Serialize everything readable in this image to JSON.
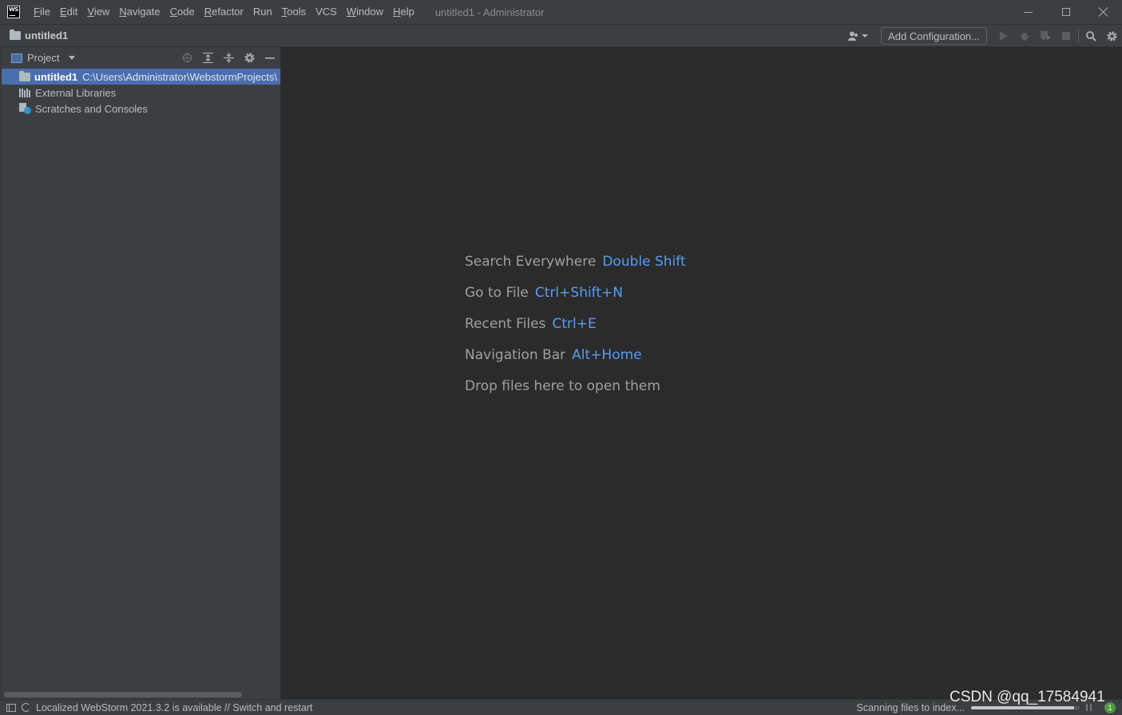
{
  "titlebar": {
    "logo_text": "WS",
    "menu": [
      {
        "label": "File",
        "mnemonic": "F",
        "rest": "ile"
      },
      {
        "label": "Edit",
        "mnemonic": "E",
        "rest": "dit"
      },
      {
        "label": "View",
        "mnemonic": "V",
        "rest": "iew"
      },
      {
        "label": "Navigate",
        "mnemonic": "N",
        "rest": "avigate"
      },
      {
        "label": "Code",
        "mnemonic": "C",
        "rest": "ode"
      },
      {
        "label": "Refactor",
        "mnemonic": "R",
        "rest": "efactor"
      },
      {
        "label": "Run",
        "mnemonic": "R",
        "rest": "un",
        "mnemonic_index": 1
      },
      {
        "label": "Tools",
        "mnemonic": "T",
        "rest": "ools"
      },
      {
        "label": "VCS",
        "mnemonic": "V",
        "rest": "CS",
        "mnemonic_index": 1
      },
      {
        "label": "Window",
        "mnemonic": "W",
        "rest": "indow"
      },
      {
        "label": "Help",
        "mnemonic": "H",
        "rest": "elp"
      }
    ],
    "window_title": "untitled1 - Administrator"
  },
  "navbar": {
    "project_name": "untitled1",
    "add_configuration_label": "Add Configuration..."
  },
  "project_panel": {
    "title": "Project",
    "tree": {
      "root_name": "untitled1",
      "root_path": "C:\\Users\\Administrator\\WebstormProjects\\",
      "items": [
        "External Libraries",
        "Scratches and Consoles"
      ]
    }
  },
  "editor": {
    "hints": [
      {
        "text": "Search Everywhere",
        "shortcut": "Double Shift"
      },
      {
        "text": "Go to File",
        "shortcut": "Ctrl+Shift+N"
      },
      {
        "text": "Recent Files",
        "shortcut": "Ctrl+E"
      },
      {
        "text": "Navigation Bar",
        "shortcut": "Alt+Home"
      },
      {
        "text": "Drop files here to open them",
        "shortcut": ""
      }
    ]
  },
  "statusbar": {
    "message": "Localized WebStorm 2021.3.2 is available // Switch and restart",
    "indexing_text": "Scanning files to index...",
    "indexing_progress": 0.95,
    "notifications_count": "1"
  },
  "watermark": "CSDN @qq_17584941",
  "colors": {
    "accent_link": "#589df6",
    "selection": "#4b6eaf",
    "panel_bg": "#3c3f41",
    "editor_bg": "#2b2b2b"
  }
}
